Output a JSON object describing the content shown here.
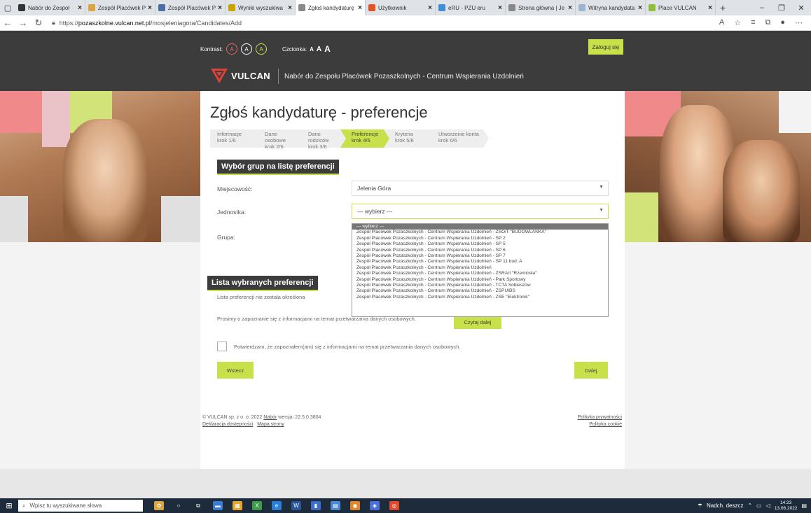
{
  "browser": {
    "tabs": [
      {
        "label": "Nabór do Zespoł",
        "color": "#333"
      },
      {
        "label": "Zespół Placówek P",
        "color": "#d9a441"
      },
      {
        "label": "Zespół Placówek P",
        "color": "#4a6fa5"
      },
      {
        "label": "Wyniki wyszukiwa",
        "color": "#c9a400"
      },
      {
        "label": "Zgłoś kandydaturę",
        "color": "#8a8a8a",
        "active": true
      },
      {
        "label": "Użytkownik",
        "color": "#e0542a"
      },
      {
        "label": "eRU - PZU eru",
        "color": "#3c8fd8"
      },
      {
        "label": "Strona główna | Je",
        "color": "#888"
      },
      {
        "label": "Witryna kandydata",
        "color": "#9cb4d0"
      },
      {
        "label": "Place VULCAN",
        "color": "#8fbf3a"
      }
    ],
    "url_prefix": "https://",
    "url_host": "pozaszkolne.vulcan.net.pl",
    "url_path": "/mosjeleniagora/Candidates/Add"
  },
  "header": {
    "contrast_label": "Kontrast:",
    "contrast_btn": "A",
    "font_label": "Czcionka:",
    "font_sizes": [
      "A",
      "A",
      "A"
    ],
    "login": "Zaloguj się",
    "logo_text": "VULCAN",
    "portal_title": "Nabór do Zespołu Placówek Pozaszkolnych - Centrum Wspierania Uzdolnień"
  },
  "page": {
    "title": "Zgłoś kandydaturę - preferencje",
    "steps": [
      {
        "name": "Informacje",
        "num": "krok 1/6"
      },
      {
        "name": "Dane osobowe",
        "num": "krok 2/6"
      },
      {
        "name": "Dane rodziców",
        "num": "krok 3/6"
      },
      {
        "name": "Preferencje",
        "num": "krok 4/6",
        "active": true
      },
      {
        "name": "Kryteria",
        "num": "krok 5/6"
      },
      {
        "name": "Utworzenie konta",
        "num": "krok 6/6"
      }
    ],
    "section1": "Wybór grup na listę preferencji",
    "town_label": "Miejscowość:",
    "town_value": "Jelenia Góra",
    "unit_label": "Jednostka:",
    "unit_value": "--- wybierz ---",
    "group_label": "Grupa:",
    "dropdown_options": [
      "--- wybierz ---",
      "Zespół Placówek Pozaszkolnych - Centrum Wspierania Uzdolnień - ZSOiT \"BUDOWLANKA\"",
      "Zespół Placówek Pozaszkolnych - Centrum Wspierania Uzdolnień - SP 2",
      "Zespół Placówek Pozaszkolnych - Centrum Wspierania Uzdolnień - SP 5",
      "Zespół Placówek Pozaszkolnych - Centrum Wspierania Uzdolnień - SP 6",
      "Zespół Placówek Pozaszkolnych - Centrum Wspierania Uzdolnień - SP 7",
      "Zespół Placówek Pozaszkolnych - Centrum Wspierania Uzdolnień - SP 11 bud. A",
      "Zespół Placówek Pozaszkolnych - Centrum Wspierania Uzdolnień",
      "Zespół Placówek Pozaszkolnych - Centrum Wspierania Uzdolnień - ZSRArt \"Rzemiosła\"",
      "Zespół Placówek Pozaszkolnych - Centrum Wspierania Uzdolnień - Park Sportowy",
      "Zespół Placówek Pozaszkolnych - Centrum Wspierania Uzdolnień - TCTA Sobieszów",
      "Zespół Placówek Pozaszkolnych - Centrum Wspierania Uzdolnień - ZSPUIBS",
      "Zespół Placówek Pozaszkolnych - Centrum Wspierania Uzdolnień - ZSE \"Elektronik\""
    ],
    "section2": "Lista wybranych preferencji",
    "no_prefs": "Lista preferencji nie została określona",
    "privacy_note": "Prosimy o zapoznanie się z informacjami na temat przetwarzania danych osobowych.",
    "read_more": "Czytaj dalej",
    "confirm_text": "Potwierdzam, że zapoznałem(am) się z informacjami na temat przetwarzania danych osobowych.",
    "back": "Wstecz",
    "next": "Dalej"
  },
  "footer": {
    "copyright": "© VULCAN sp. z o. o. 2022",
    "nabor": "Nabór",
    "version": "wersja: 22.5.0.3804",
    "accessibility": "Deklaracja dostępności",
    "sitemap": "Mapa strony",
    "privacy": "Polityka prywatności",
    "cookie": "Polityka cookie"
  },
  "taskbar": {
    "search_placeholder": "Wpisz tu wyszukiwane słowa",
    "weather": "Nadch. deszcz",
    "time": "14:23",
    "date": "13.06.2022"
  },
  "colors": {
    "accent": "#c8e04a",
    "dark": "#3c3c3c",
    "brand_red": "#e0423a"
  }
}
